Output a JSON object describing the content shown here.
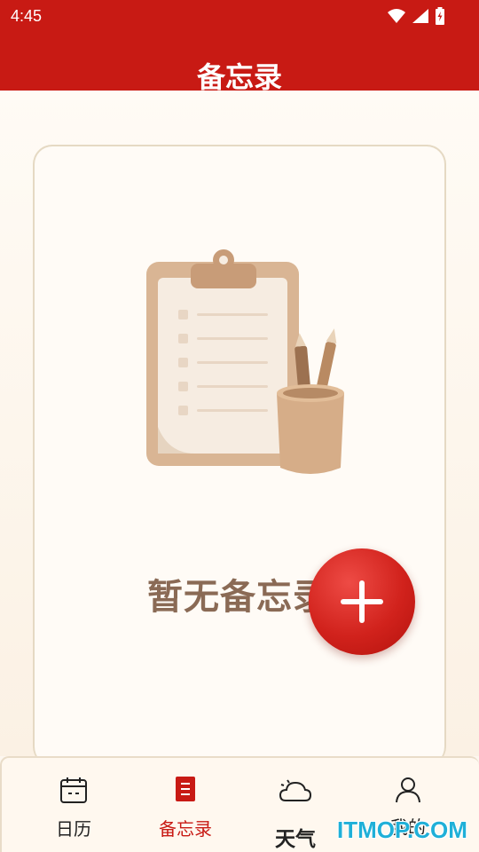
{
  "status_bar": {
    "time": "4:45",
    "icons": [
      "wifi-icon",
      "signal-icon",
      "battery-icon"
    ]
  },
  "header": {
    "title": "备忘录"
  },
  "main": {
    "empty_text": "暂无备忘录",
    "add_button_icon": "plus-icon"
  },
  "bottom_nav": {
    "items": [
      {
        "label": "日历",
        "icon": "calendar-icon",
        "active": false
      },
      {
        "label": "备忘录",
        "icon": "memo-icon",
        "active": true
      },
      {
        "label": "天气",
        "icon": "weather-icon",
        "active": false
      },
      {
        "label": "我的",
        "icon": "user-icon",
        "active": false
      }
    ]
  },
  "watermark": "ITMOP.COM",
  "colors": {
    "brand_red": "#c81a14",
    "text_brown": "#8a6a55",
    "card_border": "#e5d9c3"
  }
}
